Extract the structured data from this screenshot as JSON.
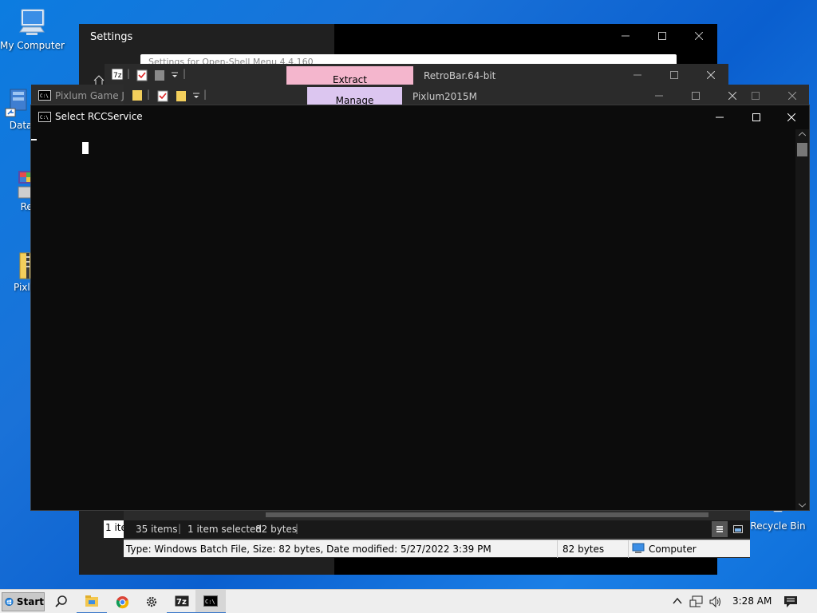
{
  "desktop": {
    "icons": [
      {
        "label": "My Computer"
      },
      {
        "label": "DataW"
      },
      {
        "label": "Retr"
      },
      {
        "label": "Pixlum"
      },
      {
        "label": "Recycle Bin"
      }
    ]
  },
  "settings_window": {
    "title": "Settings",
    "search_text": "Settings for Open-Shell Menu 4.4.160"
  },
  "retrobar_window": {
    "ribbon_tab": "Extract",
    "title": "RetroBar.64-bit"
  },
  "pixlum_window": {
    "ribbon_tab": "Manage",
    "title": "Pixlum2015M",
    "status": {
      "items": "35 items",
      "selected": "1 item selected",
      "size": "82 bytes",
      "left_fragment": "1 ite"
    },
    "details": {
      "type_text": "Type: Windows Batch File, Size: 82 bytes, Date modified: 5/27/2022 3:39 PM",
      "size": "82 bytes",
      "location": "Computer"
    }
  },
  "pixlum_game_window": {
    "title": "Pixlum Game Joi"
  },
  "console_window": {
    "title": "Select RCCService"
  },
  "taskbar": {
    "start_label": "Start",
    "clock": "3:28 AM"
  },
  "colors": {
    "desktop_blue": "#0c7ce0",
    "extract_tab": "#f4b6cd",
    "manage_tab": "#dcc6f0",
    "console_bg": "#0c0c0c"
  }
}
